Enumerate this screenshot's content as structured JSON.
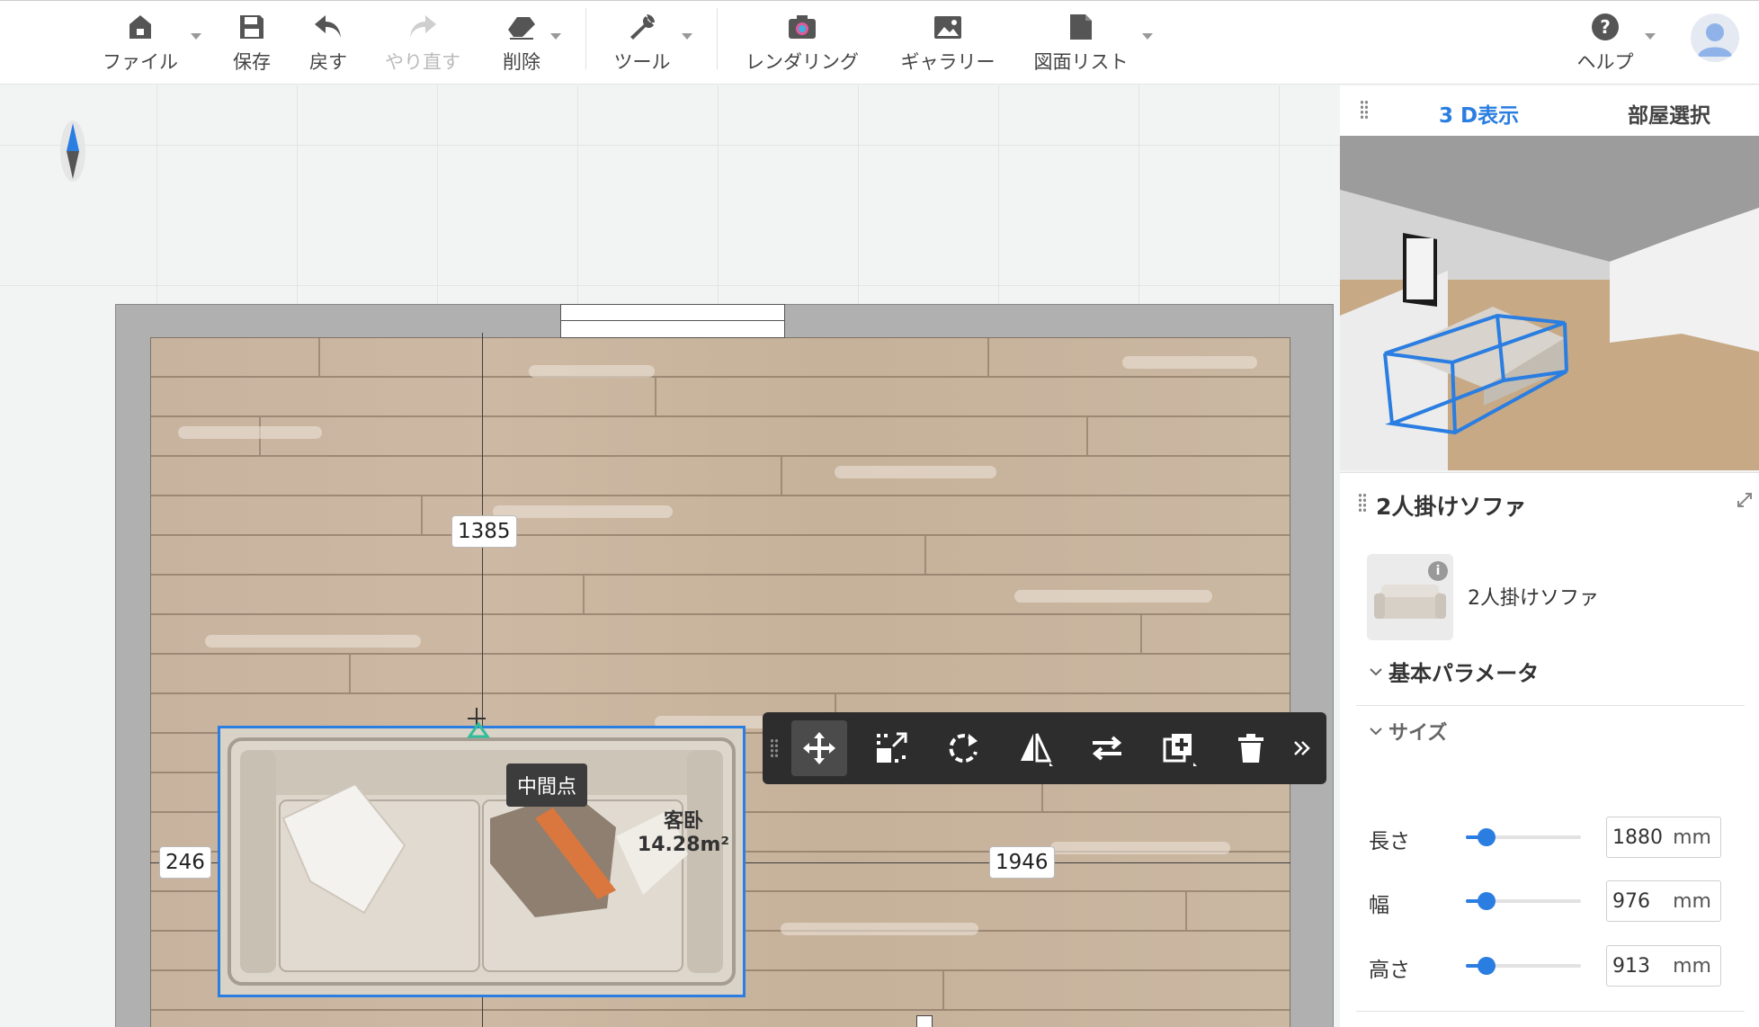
{
  "toolbar": {
    "file": "ファイル",
    "save": "保存",
    "undo": "戻す",
    "redo": "やり直す",
    "delete": "削除",
    "tools": "ツール",
    "rendering": "レンダリング",
    "gallery": "ギャラリー",
    "drawing_list": "図面リスト",
    "help": "ヘルプ"
  },
  "canvas": {
    "dim_vertical": "1385",
    "dim_left": "246",
    "dim_right": "1946",
    "tooltip": "中間点",
    "room_name": "客卧",
    "room_area": "14.28m²"
  },
  "edit_bar": {
    "tools": [
      "move-icon",
      "scale-icon",
      "rotate-icon",
      "mirror-icon",
      "swap-icon",
      "duplicate-icon",
      "trash-icon",
      "expand-more-icon"
    ]
  },
  "right_panel": {
    "tab_3d": "3 D表示",
    "tab_room": "部屋選択",
    "object_title": "2人掛けソファ",
    "object_name": "2人掛けソファ",
    "section_basic": "基本パラメータ",
    "section_size": "サイズ",
    "params": [
      {
        "label": "長さ",
        "value": "1880",
        "unit": "mm",
        "slider": 0.18
      },
      {
        "label": "幅",
        "value": "976",
        "unit": "mm",
        "slider": 0.18
      },
      {
        "label": "高さ",
        "value": "913",
        "unit": "mm",
        "slider": 0.18
      }
    ]
  },
  "colors": {
    "accent": "#2a7de1",
    "wall": "#b1b0b0",
    "floor": "#c8b49e",
    "edit_bar": "#2d2d2d"
  }
}
